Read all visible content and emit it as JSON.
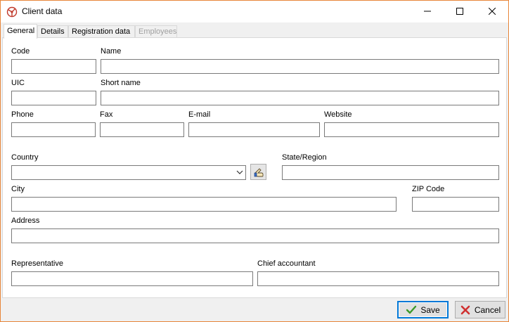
{
  "window": {
    "title": "Client data",
    "icon": "app-icon"
  },
  "tabs": [
    {
      "label": "General",
      "active": true,
      "enabled": true
    },
    {
      "label": "Details",
      "active": false,
      "enabled": true
    },
    {
      "label": "Registration data",
      "active": false,
      "enabled": true
    },
    {
      "label": "Employees",
      "active": false,
      "enabled": false
    }
  ],
  "form": {
    "code": {
      "label": "Code",
      "value": ""
    },
    "name": {
      "label": "Name",
      "value": ""
    },
    "uic": {
      "label": "UIC",
      "value": ""
    },
    "short_name": {
      "label": "Short name",
      "value": ""
    },
    "phone": {
      "label": "Phone",
      "value": ""
    },
    "fax": {
      "label": "Fax",
      "value": ""
    },
    "email": {
      "label": "E-mail",
      "value": ""
    },
    "website": {
      "label": "Website",
      "value": ""
    },
    "country": {
      "label": "Country",
      "value": ""
    },
    "state_region": {
      "label": "State/Region",
      "value": ""
    },
    "city": {
      "label": "City",
      "value": ""
    },
    "zip_code": {
      "label": "ZIP Code",
      "value": ""
    },
    "address": {
      "label": "Address",
      "value": ""
    },
    "representative": {
      "label": "Representative",
      "value": ""
    },
    "chief_accountant": {
      "label": "Chief accountant",
      "value": ""
    }
  },
  "buttons": {
    "save": {
      "label": "Save",
      "icon": "checkmark-icon"
    },
    "cancel": {
      "label": "Cancel",
      "icon": "cross-icon"
    }
  },
  "colors": {
    "window_border": "#e8863a",
    "accent": "#0078d7",
    "save_icon": "#3a9a2a",
    "cancel_icon": "#d03030"
  }
}
